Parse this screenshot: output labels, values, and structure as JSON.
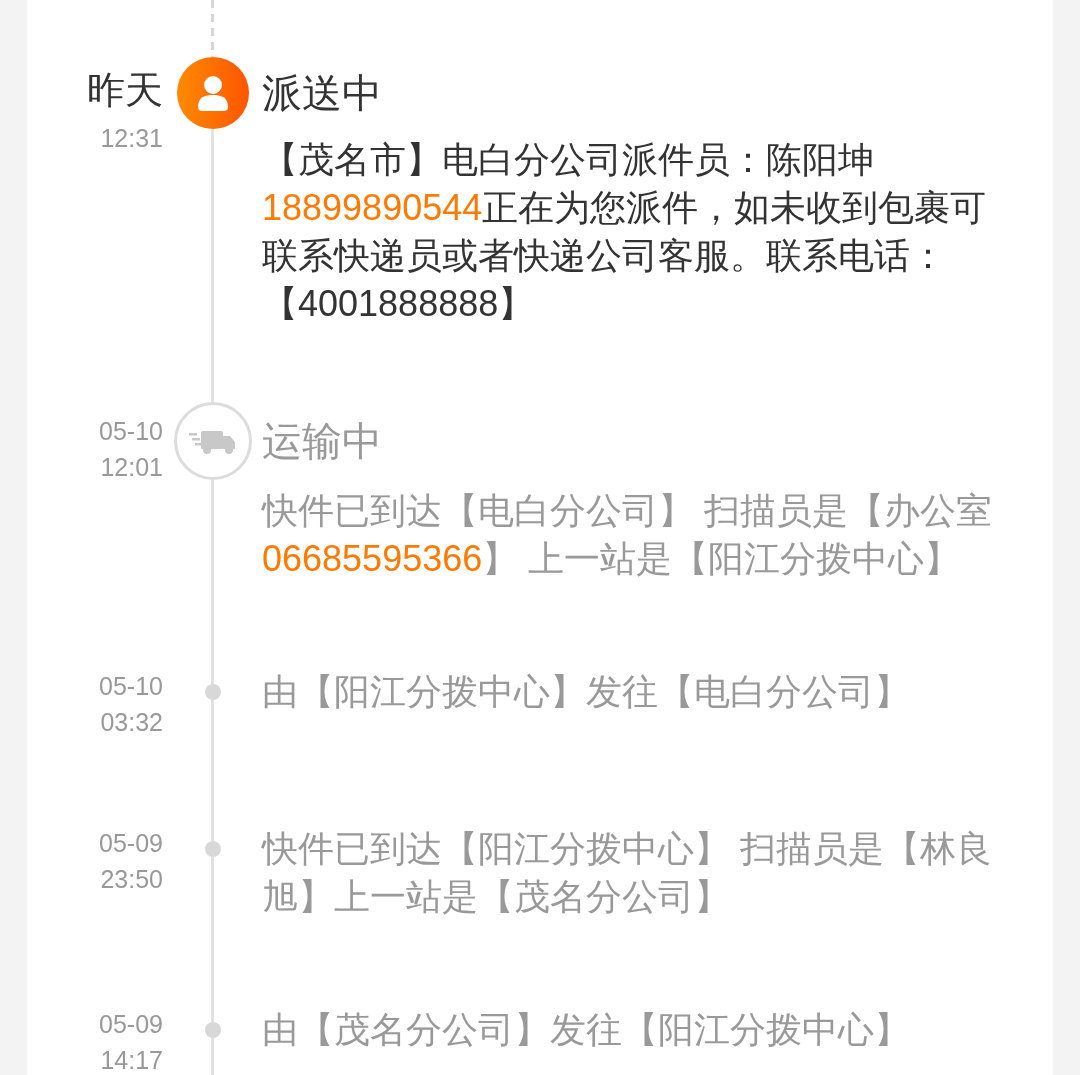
{
  "timeline": [
    {
      "kind": "courier",
      "active": true,
      "day": "昨天",
      "time": "12:31",
      "title": "派送中",
      "text": [
        {
          "kind": "plain",
          "text": "【茂名市】电白分公司派件员：陈阳坤"
        },
        {
          "kind": "phone",
          "text": "18899890544"
        },
        {
          "kind": "plain",
          "text": "正在为您派件，如未收到包裹可联系快递员或者快递公司客服。联系电话：【4001888888】"
        }
      ]
    },
    {
      "kind": "transit",
      "active": false,
      "day": "05-10",
      "time": "12:01",
      "title": "运输中",
      "text": [
        {
          "kind": "plain",
          "text": "快件已到达【电白分公司】 扫描员是【办公室"
        },
        {
          "kind": "phone",
          "text": "06685595366"
        },
        {
          "kind": "plain",
          "text": "】 上一站是【阳江分拨中心】"
        }
      ]
    },
    {
      "kind": "step",
      "active": false,
      "day": "05-10",
      "time": "03:32",
      "text": [
        {
          "kind": "plain",
          "text": "由【阳江分拨中心】发往【电白分公司】"
        }
      ]
    },
    {
      "kind": "step",
      "active": false,
      "day": "05-09",
      "time": "23:50",
      "text": [
        {
          "kind": "plain",
          "text": "快件已到达【阳江分拨中心】 扫描员是【林良旭】上一站是【茂名分公司】"
        }
      ]
    },
    {
      "kind": "step",
      "active": false,
      "day": "05-09",
      "time": "14:17",
      "text": [
        {
          "kind": "plain",
          "text": "由【茂名分公司】发往【阳江分拨中心】"
        }
      ]
    }
  ]
}
